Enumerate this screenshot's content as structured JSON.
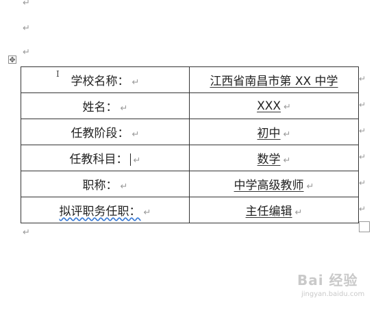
{
  "paragraph_mark": "↵",
  "end_of_row_mark": "↵",
  "move_handle_glyph": "✥",
  "table": {
    "rows": [
      {
        "label": "学校名称：",
        "value": "江西省南昌市第 XX 中学"
      },
      {
        "label": "姓名：",
        "value": "XXX"
      },
      {
        "label": "任教阶段：",
        "value": "初中"
      },
      {
        "label": "任教科目：",
        "value": "数学"
      },
      {
        "label": "职称：",
        "value": "中学高级教师"
      },
      {
        "label": "拟评职务任职：",
        "value": "主任编辑"
      }
    ]
  },
  "watermark": {
    "brand": "Bai 经验",
    "url": "jingyan.baidu.com"
  }
}
